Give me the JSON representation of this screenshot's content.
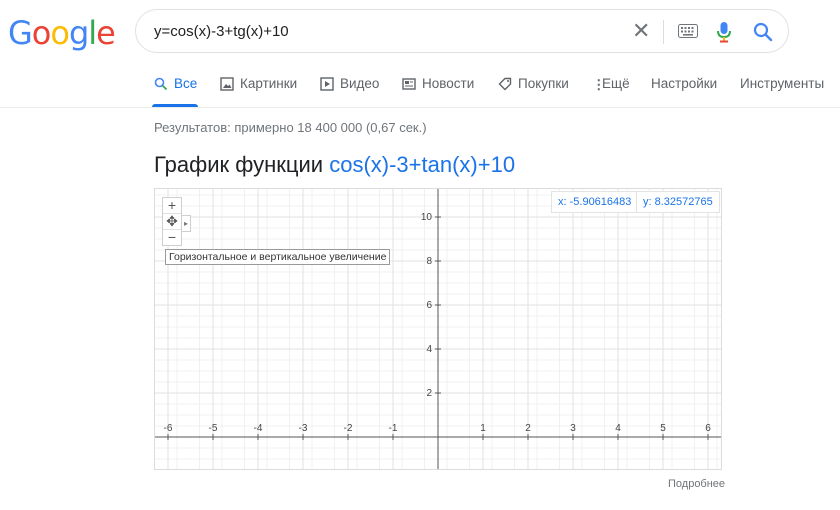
{
  "logo": {
    "letters": [
      "G",
      "o",
      "o",
      "g",
      "l",
      "e"
    ],
    "colors": [
      "#4285F4",
      "#EA4335",
      "#FBBC05",
      "#4285F4",
      "#34A853",
      "#EA4335"
    ]
  },
  "search": {
    "query": "y=cos(x)-3+tg(x)+10",
    "clear_icon": "close-icon",
    "keyboard_icon": "keyboard-icon",
    "mic_icon": "mic-icon",
    "search_icon": "search-icon"
  },
  "tabs": [
    {
      "label": "Все",
      "icon": "search-icon",
      "active": true
    },
    {
      "label": "Картинки",
      "icon": "image-icon"
    },
    {
      "label": "Видео",
      "icon": "video-icon"
    },
    {
      "label": "Новости",
      "icon": "news-icon"
    },
    {
      "label": "Покупки",
      "icon": "tag-icon"
    },
    {
      "label": "Ещё",
      "icon": "more-vert-icon"
    },
    {
      "label": "Настройки"
    },
    {
      "label": "Инструменты"
    }
  ],
  "stats": "Результатов: примерно 18 400 000 (0,67 сек.)",
  "graph_title": {
    "prefix": "График функции",
    "function": "cos(x)-3+tan(x)+10"
  },
  "graph": {
    "coord_x": "x: -5.90616483",
    "coord_y": "y: 8.32572765",
    "zoom_in": "+",
    "pan": "✥",
    "zoom_out": "−",
    "tooltip": "Горизонтальное и вертикальное увеличение",
    "more_link": "Подробнее"
  },
  "chart_data": {
    "type": "line",
    "function": "cos(x)-3+tan(x)+10",
    "xlim": [
      -6.3,
      6.3
    ],
    "ylim": [
      -1.5,
      11.3
    ],
    "x_ticks": [
      -6,
      -5,
      -4,
      -3,
      -2,
      -1,
      1,
      2,
      3,
      4,
      5,
      6
    ],
    "y_ticks": [
      2,
      4,
      6,
      8,
      10
    ],
    "grid": true,
    "series_color": "#1a73e8"
  }
}
